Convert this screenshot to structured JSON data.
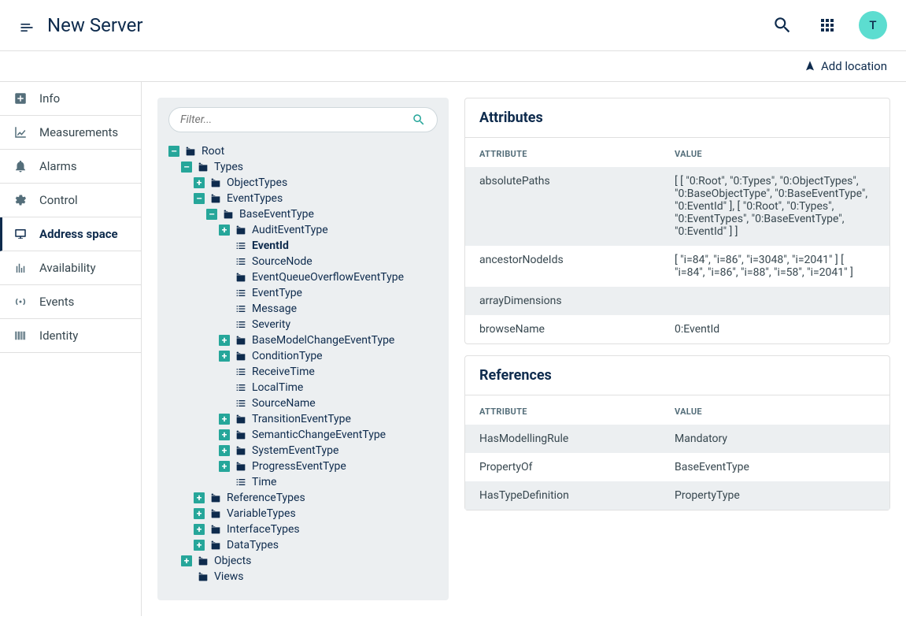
{
  "header": {
    "title": "New Server",
    "avatar": "T"
  },
  "subheader": {
    "addLocation": "Add location"
  },
  "nav": [
    {
      "id": "info",
      "label": "Info"
    },
    {
      "id": "measurements",
      "label": "Measurements"
    },
    {
      "id": "alarms",
      "label": "Alarms"
    },
    {
      "id": "control",
      "label": "Control"
    },
    {
      "id": "address-space",
      "label": "Address space",
      "active": true
    },
    {
      "id": "availability",
      "label": "Availability"
    },
    {
      "id": "events",
      "label": "Events"
    },
    {
      "id": "identity",
      "label": "Identity"
    }
  ],
  "filter": {
    "placeholder": "Filter..."
  },
  "tree": {
    "root": {
      "label": "Root",
      "exp": "minus",
      "icon": "folder"
    },
    "types": {
      "label": "Types",
      "exp": "minus",
      "icon": "folder"
    },
    "objectTypes": {
      "label": "ObjectTypes",
      "exp": "plus",
      "icon": "folder"
    },
    "eventTypes": {
      "label": "EventTypes",
      "exp": "minus",
      "icon": "folder"
    },
    "baseEventType": {
      "label": "BaseEventType",
      "exp": "minus",
      "icon": "folder"
    },
    "auditEventType": {
      "label": "AuditEventType",
      "exp": "plus",
      "icon": "folder"
    },
    "eventId": {
      "label": "EventId",
      "icon": "list",
      "selected": true
    },
    "sourceNode": {
      "label": "SourceNode",
      "icon": "list"
    },
    "eventQueueOverflow": {
      "label": "EventQueueOverflowEventType",
      "icon": "folder"
    },
    "eventType": {
      "label": "EventType",
      "icon": "list"
    },
    "message": {
      "label": "Message",
      "icon": "list"
    },
    "severity": {
      "label": "Severity",
      "icon": "list"
    },
    "baseModelChange": {
      "label": "BaseModelChangeEventType",
      "exp": "plus",
      "icon": "folder"
    },
    "conditionType": {
      "label": "ConditionType",
      "exp": "plus",
      "icon": "folder"
    },
    "receiveTime": {
      "label": "ReceiveTime",
      "icon": "list"
    },
    "localTime": {
      "label": "LocalTime",
      "icon": "list"
    },
    "sourceName": {
      "label": "SourceName",
      "icon": "list"
    },
    "transitionEvent": {
      "label": "TransitionEventType",
      "exp": "plus",
      "icon": "folder"
    },
    "semanticChange": {
      "label": "SemanticChangeEventType",
      "exp": "plus",
      "icon": "folder"
    },
    "systemEvent": {
      "label": "SystemEventType",
      "exp": "plus",
      "icon": "folder"
    },
    "progressEvent": {
      "label": "ProgressEventType",
      "exp": "plus",
      "icon": "folder"
    },
    "time": {
      "label": "Time",
      "icon": "list"
    },
    "referenceTypes": {
      "label": "ReferenceTypes",
      "exp": "plus",
      "icon": "folder"
    },
    "variableTypes": {
      "label": "VariableTypes",
      "exp": "plus",
      "icon": "folder"
    },
    "interfaceTypes": {
      "label": "InterfaceTypes",
      "exp": "plus",
      "icon": "folder"
    },
    "dataTypes": {
      "label": "DataTypes",
      "exp": "plus",
      "icon": "folder"
    },
    "objects": {
      "label": "Objects",
      "exp": "plus",
      "icon": "folder"
    },
    "views": {
      "label": "Views",
      "icon": "folder"
    }
  },
  "attributes": {
    "title": "Attributes",
    "cols": {
      "attr": "ATTRIBUTE",
      "val": "VALUE"
    },
    "rows": [
      {
        "attr": "absolutePaths",
        "val": "[ [ \"0:Root\", \"0:Types\", \"0:ObjectTypes\", \"0:BaseObjectType\", \"0:BaseEventType\", \"0:EventId\" ], [ \"0:Root\", \"0:Types\", \"0:EventTypes\", \"0:BaseEventType\", \"0:EventId\" ] ]",
        "odd": true
      },
      {
        "attr": "ancestorNodeIds",
        "val": "[ \"i=84\", \"i=86\", \"i=3048\", \"i=2041\" ] [ \"i=84\", \"i=86\", \"i=88\", \"i=58\", \"i=2041\" ]",
        "link": true
      },
      {
        "attr": "arrayDimensions",
        "val": "",
        "odd": true
      },
      {
        "attr": "browseName",
        "val": "0:EventId"
      }
    ]
  },
  "references": {
    "title": "References",
    "cols": {
      "attr": "ATTRIBUTE",
      "val": "VALUE"
    },
    "rows": [
      {
        "attr": "HasModellingRule",
        "val": "Mandatory",
        "odd": true
      },
      {
        "attr": "PropertyOf",
        "val": "BaseEventType"
      },
      {
        "attr": "HasTypeDefinition",
        "val": "PropertyType",
        "odd": true
      }
    ]
  }
}
